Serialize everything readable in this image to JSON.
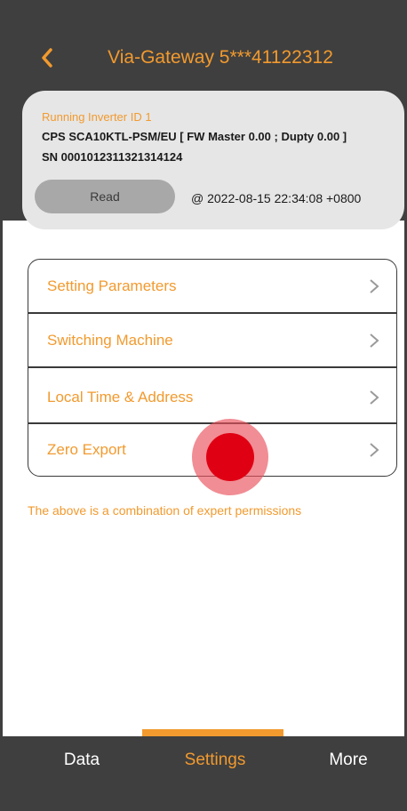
{
  "header": {
    "title": "Via-Gateway 5***41122312",
    "back_icon": "chevron-left-icon"
  },
  "device_card": {
    "running_id": "Running Inverter ID 1",
    "model": "CPS SCA10KTL-PSM/EU [ FW Master 0.00 ; Dupty 0.00 ]",
    "sn": "SN 0001012311321314124",
    "read_label": "Read",
    "timestamp": "@ 2022-08-15 22:34:08 +0800"
  },
  "menu": {
    "items": [
      {
        "label": "Setting Parameters"
      },
      {
        "label": "Switching Machine"
      },
      {
        "label": "Local Time & Address"
      },
      {
        "label": "Zero Export"
      }
    ],
    "chevron_icon": "chevron-right-icon"
  },
  "notice": "The above is a combination of expert permissions",
  "bottom_nav": {
    "items": [
      {
        "label": "Data"
      },
      {
        "label": "Settings"
      },
      {
        "label": "More"
      }
    ],
    "active": "Settings"
  },
  "colors": {
    "accent": "#f29a2e",
    "header_bg": "#3f3f3f",
    "card_bg": "#e6e6e6",
    "tap_indicator": "#e00013"
  }
}
